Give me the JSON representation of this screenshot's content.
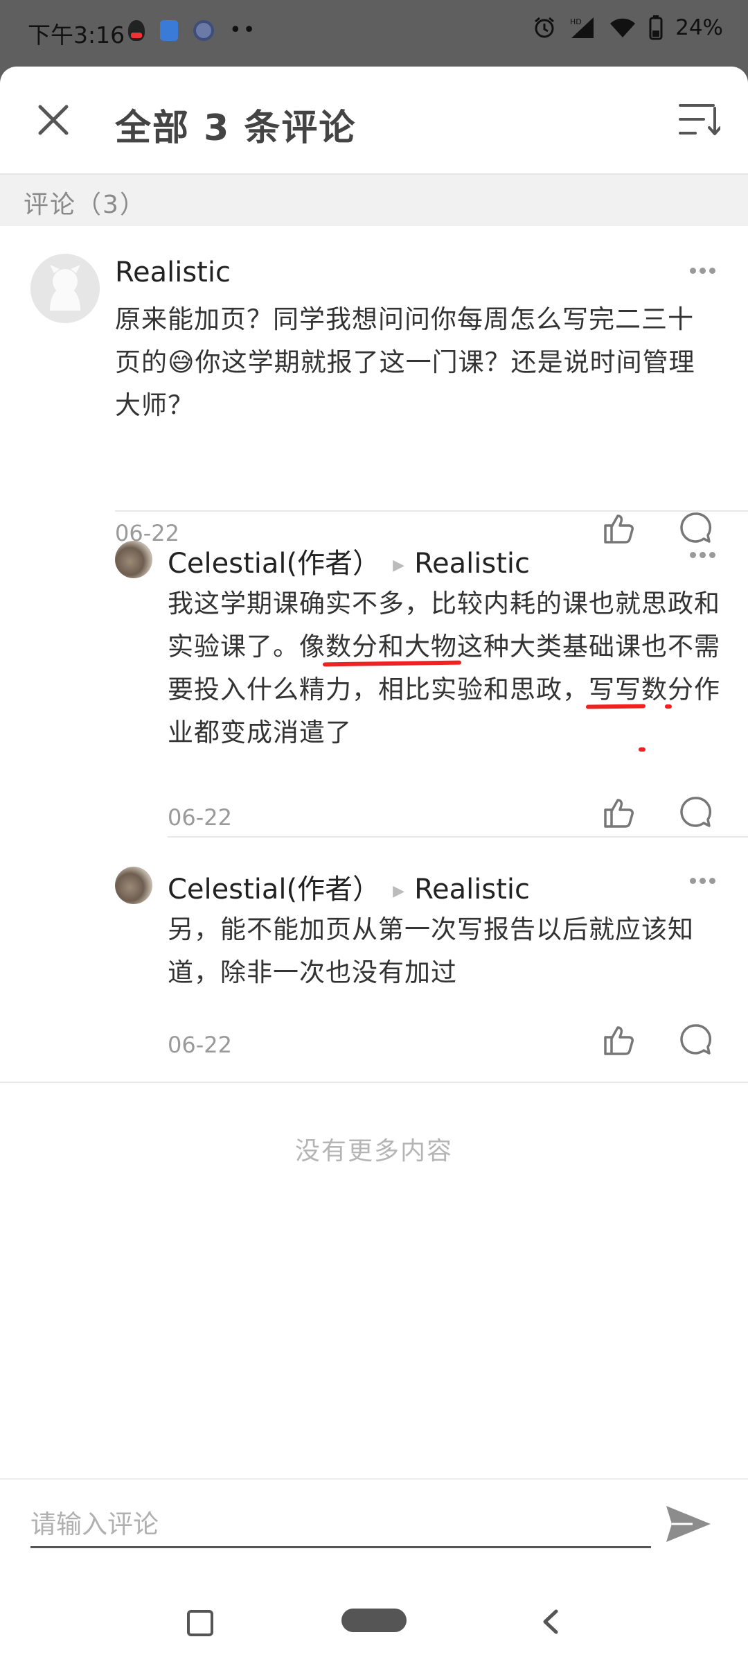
{
  "status_bar": {
    "time": "下午3:16",
    "battery": "24%",
    "network_badge": "HD"
  },
  "header": {
    "title": "全部 3 条评论",
    "close_icon": "close-icon",
    "sort_icon": "sort-icon"
  },
  "section": {
    "label": "评论（3）"
  },
  "comments": [
    {
      "author": "Realistic",
      "text_parts": [
        "原来能加页？同学我想问问你每周怎么写完二三十页的",
        "😅",
        "你这学期就报了这一门课？还是说时间管理大师？"
      ],
      "date": "06-22"
    },
    {
      "author": "Celestial(作者）",
      "reply_to": "Realistic",
      "text_parts": [
        "我这学期课确实不多，比较内耗的课也就思政和实验课了。像",
        "数分和大物",
        "这种大类基础课也",
        "不需要投入什么精力",
        "，相比实验和思政，",
        "写写",
        "数分作业都变成消遣",
        "了"
      ],
      "date": "06-22"
    },
    {
      "author": "Celestial(作者）",
      "reply_to": "Realistic",
      "text": "另，能不能加页从第一次写报告以后就应该知道，除非一次也没有加过",
      "date": "06-22"
    }
  ],
  "footer": {
    "no_more": "没有更多内容"
  },
  "input": {
    "placeholder": "请输入评论"
  },
  "colors": {
    "highlight_red": "#e22222",
    "divider": "#e8e8e8",
    "section_bg": "#f1f1f1"
  }
}
